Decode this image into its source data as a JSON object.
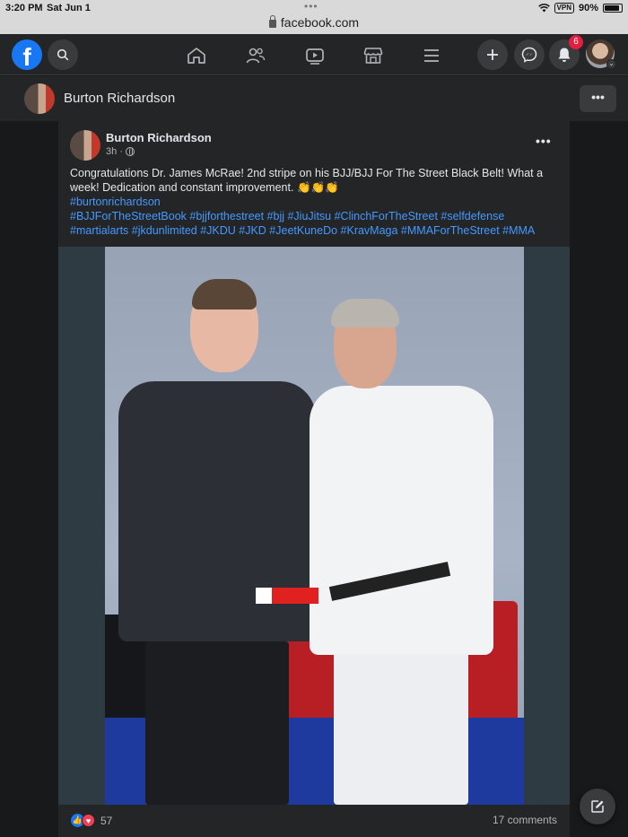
{
  "status_bar": {
    "time": "3:20 PM",
    "date": "Sat Jun 1",
    "url": "facebook.com",
    "vpn": "VPN",
    "battery": "90%",
    "battery_level": 0.9
  },
  "nav": {
    "logo": "f",
    "icons": [
      "search-icon",
      "home-icon",
      "friends-icon",
      "watch-icon",
      "marketplace-icon",
      "menu-icon",
      "plus-icon",
      "messenger-icon",
      "bell-icon"
    ],
    "notifications_count": "6"
  },
  "page_header": {
    "name": "Burton Richardson",
    "more": "•••"
  },
  "post": {
    "author": "Burton Richardson",
    "time": "3h ·",
    "more": "•••",
    "text": "Congratulations Dr. James McRae! 2nd stripe on his BJJ/BJJ For The Street Black Belt! What a week! Dedication and constant improvement.",
    "claps": "👏👏👏",
    "hashtag_line1": "#burtonrichardson",
    "hashtag_line2": "#BJJForTheStreetBook #bjjforthestreet #bjj #JiuJitsu #ClinchForTheStreet #selfdefense",
    "hashtag_line3": "#martialarts #jkdunlimited #JKDU #JKD #JeetKuneDo #KravMaga #MMAForTheStreet #MMA",
    "reaction_count": "57",
    "comments": "17 comments"
  },
  "colors": {
    "background": "#18191a",
    "card": "#242526",
    "accent": "#1877f2",
    "link": "#4599ff",
    "badge": "#e41e3f"
  }
}
